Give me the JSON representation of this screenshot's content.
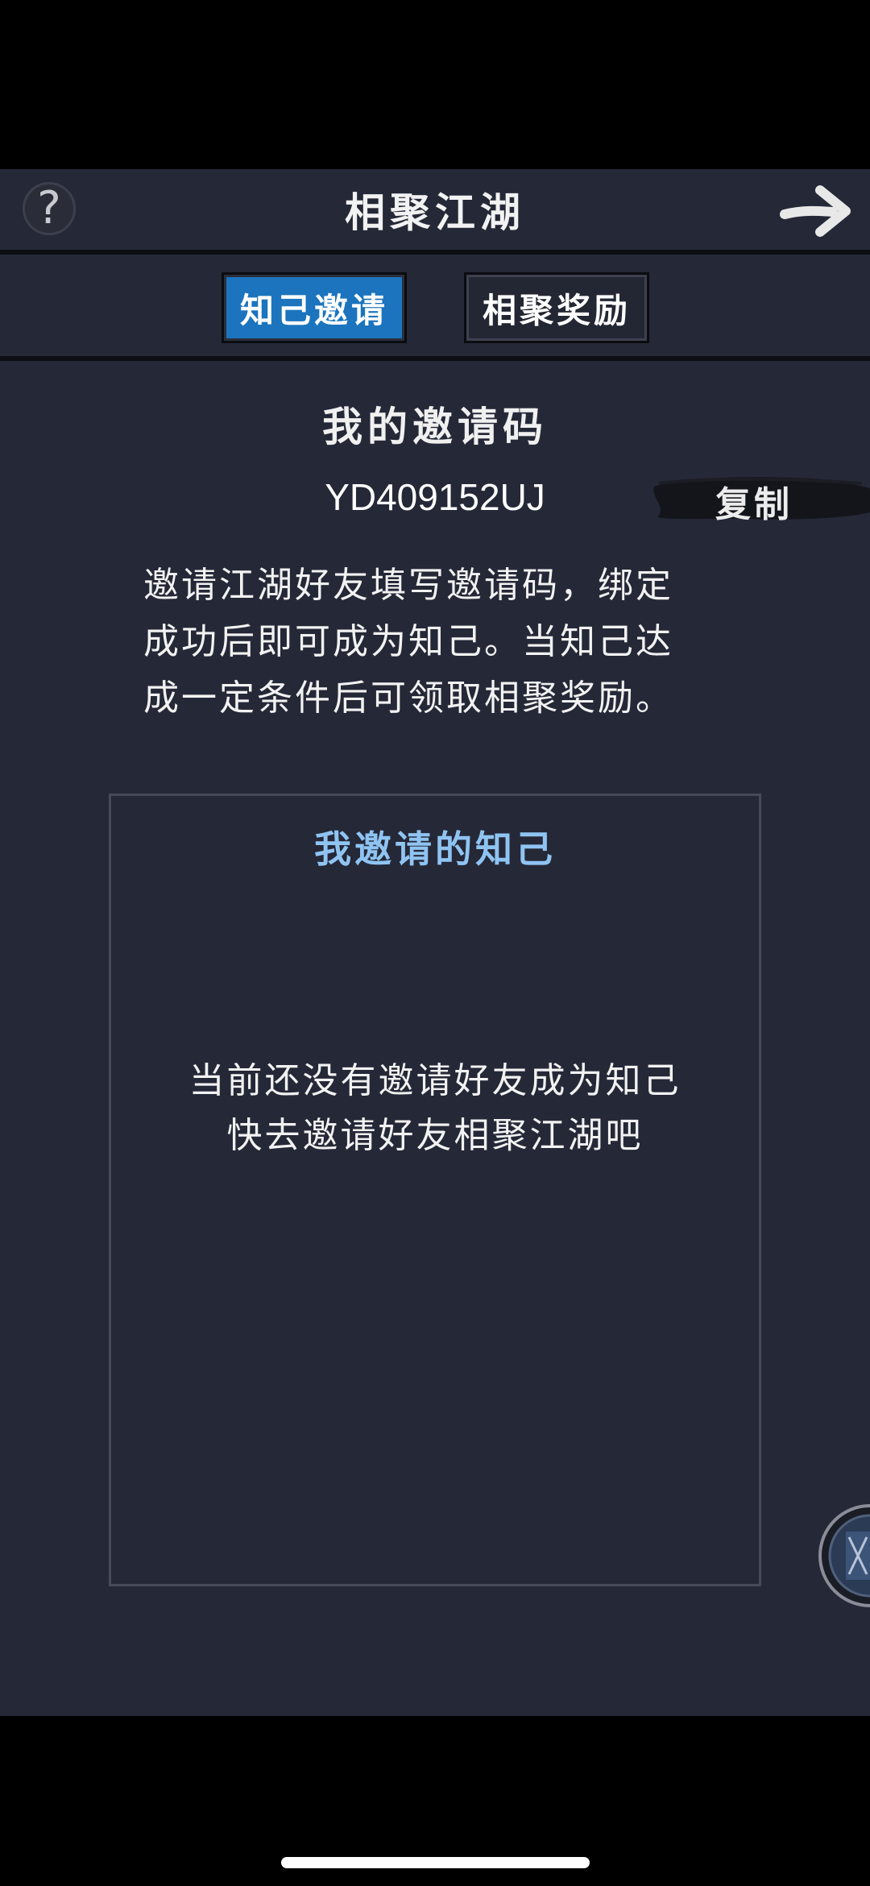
{
  "header": {
    "title": "相聚江湖",
    "help_icon": "question-circle-icon",
    "next_icon": "arrow-right-icon"
  },
  "tabs": [
    {
      "label": "知己邀请",
      "active": true
    },
    {
      "label": "相聚奖励",
      "active": false
    }
  ],
  "invite": {
    "section_title": "我的邀请码",
    "code": "YD409152UJ",
    "copy_label": "复制",
    "description_lines": [
      "邀请江湖好友填写邀请码，绑定",
      "成功后即可成为知己。当知己达",
      "成一定条件后可领取相聚奖励。"
    ]
  },
  "friends_panel": {
    "title": "我邀请的知己",
    "empty_lines": [
      "当前还没有邀请好友成为知己",
      "快去邀请好友相聚江湖吧"
    ]
  },
  "colors": {
    "background": "#252837",
    "tab_active": "#1b74bd",
    "panel_title": "#8fc4f2"
  }
}
